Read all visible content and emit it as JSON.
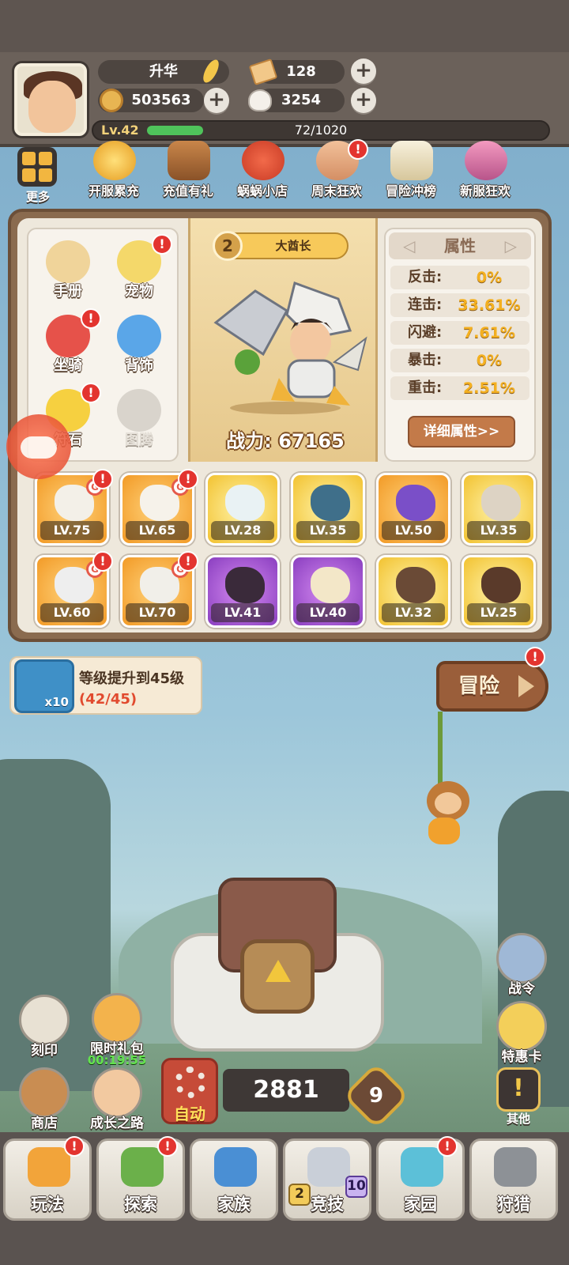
{
  "header": {
    "title_name": "升华",
    "ticket_count": "128",
    "coin_count": "503563",
    "shell_count": "3254",
    "level": "Lv.42",
    "xp_text": "72/1020",
    "xp_progress": 0.0706,
    "plus": "+"
  },
  "top_events": [
    {
      "label": "更多"
    },
    {
      "label": "开服累充"
    },
    {
      "label": "充值有礼"
    },
    {
      "label": "蜗蜗小店"
    },
    {
      "label": "周末狂欢"
    },
    {
      "label": "冒险冲榜"
    },
    {
      "label": "新服狂欢"
    }
  ],
  "badge": "!",
  "left_menu": [
    {
      "label": "手册"
    },
    {
      "label": "宠物"
    },
    {
      "label": "坐骑"
    },
    {
      "label": "背饰"
    },
    {
      "label": "符石"
    },
    {
      "label": "图腾"
    }
  ],
  "hero": {
    "rank": "2",
    "title": "大酋长",
    "power": "战力: 67165"
  },
  "attributes": {
    "heading": "属性",
    "rows": [
      {
        "key": "反击:",
        "value": "0%"
      },
      {
        "key": "连击:",
        "value": "33.61%"
      },
      {
        "key": "闪避:",
        "value": "7.61%"
      },
      {
        "key": "暴击:",
        "value": "0%"
      },
      {
        "key": "重击:",
        "value": "2.51%"
      }
    ],
    "detail_button": "详细属性>>"
  },
  "equipment": [
    {
      "level": "LV.75",
      "rarity": "orange"
    },
    {
      "level": "LV.65",
      "rarity": "orange"
    },
    {
      "level": "LV.28",
      "rarity": "gold"
    },
    {
      "level": "LV.35",
      "rarity": "gold"
    },
    {
      "level": "LV.50",
      "rarity": "orange"
    },
    {
      "level": "LV.35",
      "rarity": "gold"
    },
    {
      "level": "LV.60",
      "rarity": "orange"
    },
    {
      "level": "LV.70",
      "rarity": "orange"
    },
    {
      "level": "LV.41",
      "rarity": "purple"
    },
    {
      "level": "LV.40",
      "rarity": "purple"
    },
    {
      "level": "LV.32",
      "rarity": "gold"
    },
    {
      "level": "LV.25",
      "rarity": "gold"
    }
  ],
  "equip_mark": "G",
  "quest": {
    "reward_count": "x10",
    "title": "等级提升到45级",
    "progress": "(42/45)"
  },
  "adventure": {
    "label": "冒险"
  },
  "side_left": {
    "engrave": "刻印",
    "gift": "限时礼包",
    "gift_timer": "00:19:55",
    "shop": "商店",
    "growth": "成长之路"
  },
  "side_right": {
    "battle_pass": "战令",
    "special_card": "特惠卡",
    "other": "其他",
    "other_icon": "!"
  },
  "center_controls": {
    "auto": "自动",
    "count": "2881",
    "hex_level": "9"
  },
  "bottom_nav": [
    {
      "label": "玩法"
    },
    {
      "label": "探索"
    },
    {
      "label": "家族"
    },
    {
      "label": "竞技",
      "left_num": "2",
      "right_num": "10"
    },
    {
      "label": "家园"
    },
    {
      "label": "狩猎"
    }
  ]
}
